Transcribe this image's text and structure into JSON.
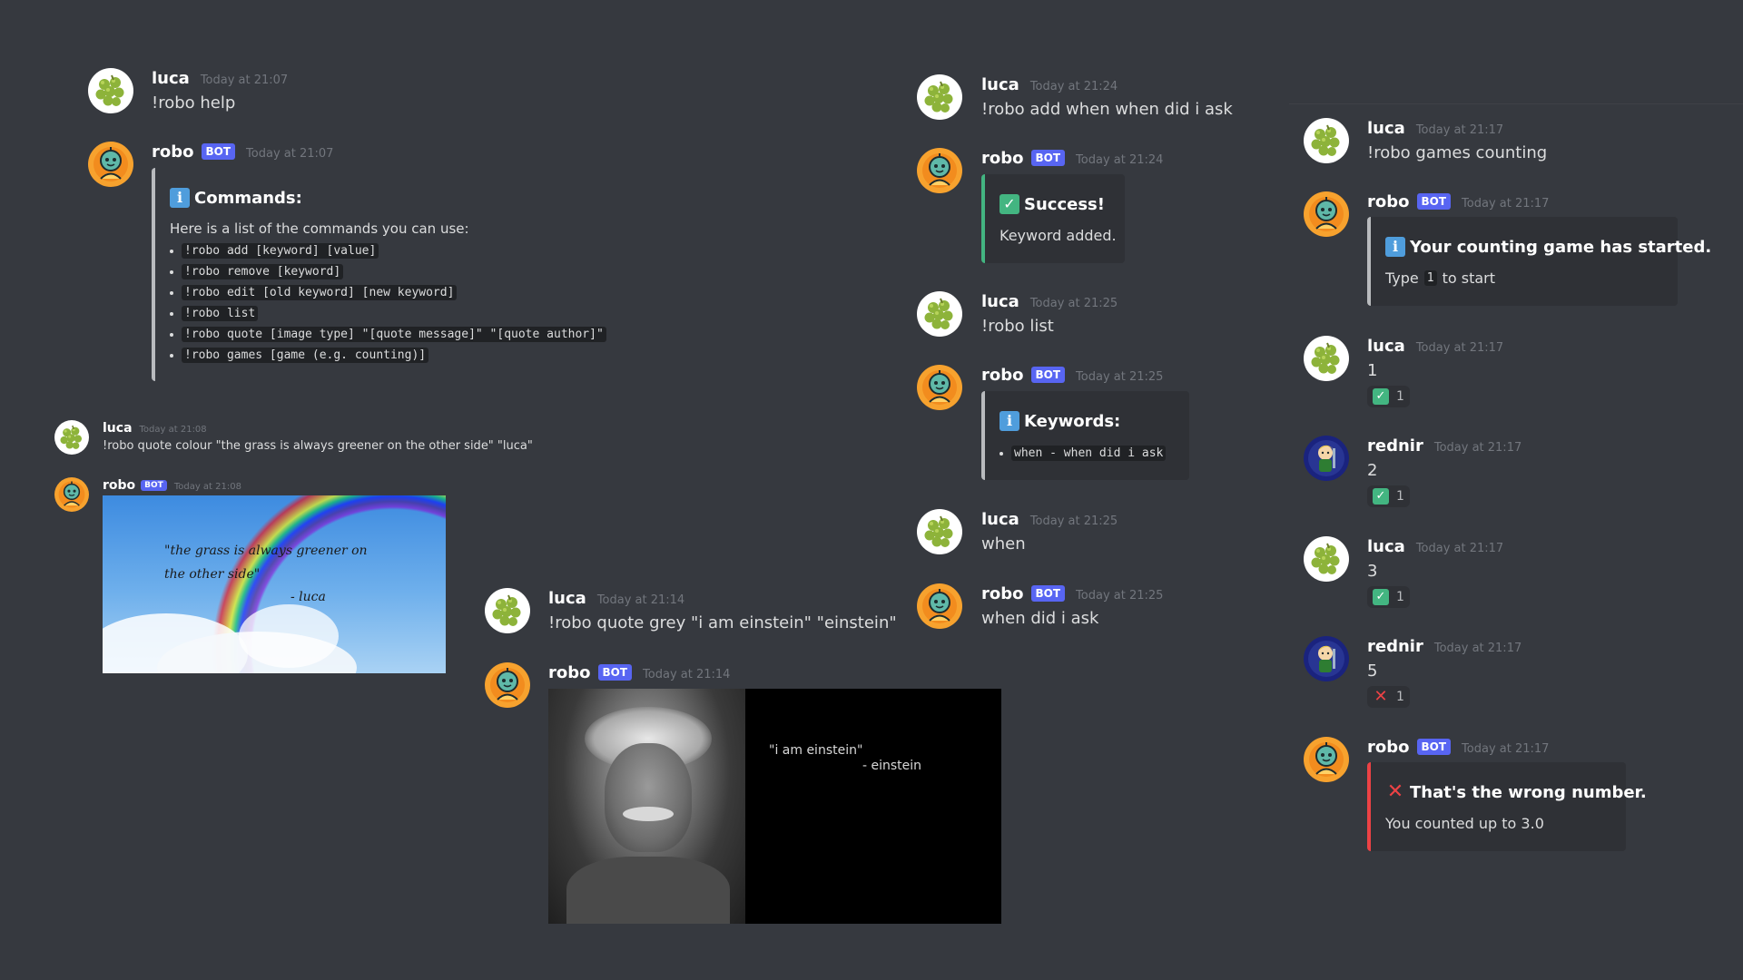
{
  "users": {
    "luca": "luca",
    "robo": "robo",
    "rednir": "rednir",
    "bot_tag": "BOT"
  },
  "icons": {
    "luca_avatar": "grapes-avatar-icon",
    "robo_avatar": "robot-avatar-icon",
    "rednir_avatar": "character-avatar-icon",
    "info": "info-icon",
    "success": "check-icon",
    "error": "cross-icon"
  },
  "colors": {
    "background": "#36393f",
    "embed_bg": "#2f3136",
    "bot_badge": "#5865f2",
    "info_bar": "#b9bbbe",
    "success_bar": "#43b581",
    "error_bar": "#ed4245"
  },
  "col1": {
    "m1": {
      "time": "Today at 21:07",
      "text": "!robo help"
    },
    "m2": {
      "time": "Today at 21:07",
      "embed_title": "Commands:",
      "embed_intro": "Here is a list of the commands you can use:",
      "commands": [
        "!robo add [keyword] [value]",
        "!robo remove [keyword]",
        "!robo edit [old keyword] [new keyword]",
        "!robo list",
        "!robo quote [image type] \"[quote message]\" \"[quote author]\"",
        "!robo games [game (e.g. counting)]"
      ]
    },
    "m3": {
      "time": "Today at 21:08",
      "text": "!robo quote colour \"the grass is always greener on the other side\" \"luca\""
    },
    "m4": {
      "time": "Today at 21:08",
      "image_quote_line1": "\"the grass is always greener on",
      "image_quote_line2": "the other side\"",
      "image_author": "- luca"
    }
  },
  "col2": {
    "m1": {
      "time": "Today at 21:14",
      "text": "!robo quote grey \"i am einstein\" \"einstein\""
    },
    "m2": {
      "time": "Today at 21:14",
      "image_quote": "\"i am einstein\"",
      "image_author": "- einstein"
    }
  },
  "col3": {
    "m1": {
      "time": "Today at 21:24",
      "text": "!robo add when when did i ask"
    },
    "m2": {
      "time": "Today at 21:24",
      "embed_title": "Success!",
      "embed_desc": "Keyword added."
    },
    "m3": {
      "time": "Today at 21:25",
      "text": "!robo list"
    },
    "m4": {
      "time": "Today at 21:25",
      "embed_title": "Keywords:",
      "keyword_item": "when - when did i ask"
    },
    "m5": {
      "time": "Today at 21:25",
      "text": "when"
    },
    "m6": {
      "time": "Today at 21:25",
      "text": "when did i ask"
    }
  },
  "col4": {
    "m1": {
      "time": "Today at 21:17",
      "text": "!robo games counting"
    },
    "m2": {
      "time": "Today at 21:17",
      "embed_title": "Your counting game has started.",
      "desc_prefix": "Type",
      "desc_code": "1",
      "desc_suffix": "to start"
    },
    "m3": {
      "time": "Today at 21:17",
      "text": "1",
      "reaction_count": "1"
    },
    "m4": {
      "time": "Today at 21:17",
      "text": "2",
      "reaction_count": "1"
    },
    "m5": {
      "time": "Today at 21:17",
      "text": "3",
      "reaction_count": "1"
    },
    "m6": {
      "time": "Today at 21:17",
      "text": "5",
      "reaction_count": "1"
    },
    "m7": {
      "time": "Today at 21:17",
      "embed_title": "That's the wrong number.",
      "embed_desc": "You counted up to 3.0"
    }
  }
}
